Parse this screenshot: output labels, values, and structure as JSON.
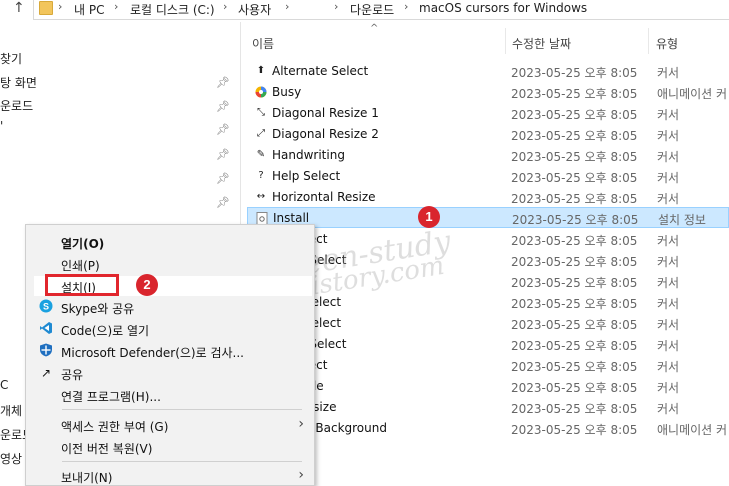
{
  "address": {
    "crumbs": [
      "내 PC",
      "로컬 디스크 (C:)",
      "사용자",
      "다운로드",
      "macOS cursors for Windows"
    ]
  },
  "nav": {
    "items": [
      "찾기",
      "탕 화면",
      "운로드",
      "'"
    ],
    "lower_fragments": [
      "C",
      "개체",
      "운로드",
      "영상"
    ]
  },
  "columns": {
    "name": "이름",
    "date": "수정한 날짜",
    "type": "유형"
  },
  "files": [
    {
      "name": "Alternate Select",
      "date": "2023-05-25 오후 8:05",
      "type": "커서",
      "icon": "arrow-up-icon"
    },
    {
      "name": "Busy",
      "date": "2023-05-25 오후 8:05",
      "type": "애니메이션 커",
      "icon": "busy-wheel-icon"
    },
    {
      "name": "Diagonal Resize 1",
      "date": "2023-05-25 오후 8:05",
      "type": "커서",
      "icon": "diagonal-resize-icon"
    },
    {
      "name": "Diagonal Resize 2",
      "date": "2023-05-25 오후 8:05",
      "type": "커서",
      "icon": "diagonal-resize-icon"
    },
    {
      "name": "Handwriting",
      "date": "2023-05-25 오후 8:05",
      "type": "커서",
      "icon": "pen-icon"
    },
    {
      "name": "Help Select",
      "date": "2023-05-25 오후 8:05",
      "type": "커서",
      "icon": "help-icon"
    },
    {
      "name": "Horizontal Resize",
      "date": "2023-05-25 오후 8:05",
      "type": "커서",
      "icon": "horizontal-resize-icon"
    },
    {
      "name": "Install",
      "date": "2023-05-25 오후 8:05",
      "type": "설치 정보",
      "icon": "setup-file-icon"
    },
    {
      "name": "elect",
      "date": "2023-05-25 오후 8:05",
      "type": "커서",
      "icon": ""
    },
    {
      "name": "n Select",
      "date": "2023-05-25 오후 8:05",
      "type": "커서",
      "icon": ""
    },
    {
      "name": "",
      "date": "2023-05-25 오후 8:05",
      "type": "커서",
      "icon": ""
    },
    {
      "name": "Select",
      "date": "2023-05-25 오후 8:05",
      "type": "커서",
      "icon": ""
    },
    {
      "name": "Select",
      "date": "2023-05-25 오후 8:05",
      "type": "커서",
      "icon": ""
    },
    {
      "name": "n Select",
      "date": "2023-05-25 오후 8:05",
      "type": "커서",
      "icon": ""
    },
    {
      "name": "elect",
      "date": "2023-05-25 오후 8:05",
      "type": "커서",
      "icon": ""
    },
    {
      "name": "able",
      "date": "2023-05-25 오후 8:05",
      "type": "커서",
      "icon": ""
    },
    {
      "name": "Resize",
      "date": "2023-05-25 오후 8:05",
      "type": "커서",
      "icon": ""
    },
    {
      "name": "g In Background",
      "date": "2023-05-25 오후 8:05",
      "type": "애니메이션 커",
      "icon": ""
    }
  ],
  "context_menu": {
    "open": "열기(O)",
    "print": "인쇄(P)",
    "install": "설치(I)",
    "skype": "Skype와 공유",
    "code": "Code(으)로 열기",
    "defender": "Microsoft Defender(으)로 검사...",
    "share": "공유",
    "open_with": "연결 프로그램(H)...",
    "access": "액세스 권한 부여 (G)",
    "restore": "이전 버전 복원(V)",
    "send_to": "보내기(N)"
  },
  "badges": {
    "one": "1",
    "two": "2"
  },
  "watermark": {
    "line1": "green-study",
    "line2": "tistory.com"
  },
  "colors": {
    "selection": "#cce8ff",
    "badge": "#d9252d",
    "highlight_box": "#e1262d"
  }
}
